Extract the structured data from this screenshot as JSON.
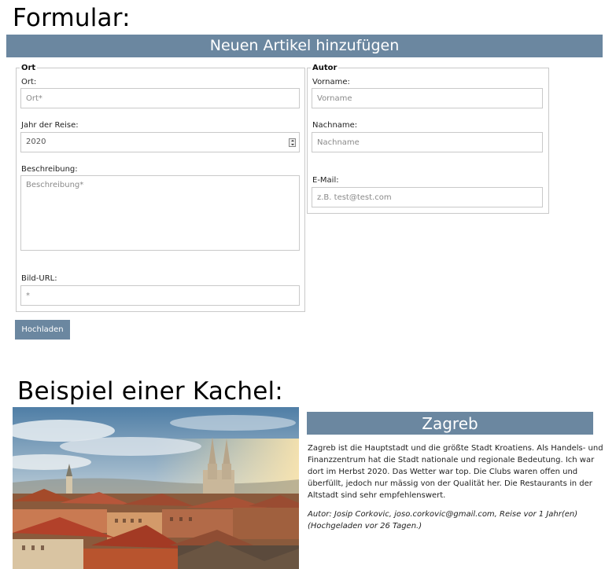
{
  "headings": {
    "form": "Formular:",
    "tile": "Beispiel einer Kachel:"
  },
  "form": {
    "title": "Neuen Artikel hinzufügen",
    "ort_group": {
      "legend": "Ort",
      "ort_label": "Ort:",
      "ort_placeholder": "Ort*",
      "year_label": "Jahr der Reise:",
      "year_value": "2020",
      "desc_label": "Beschreibung:",
      "desc_placeholder": "Beschreibung*",
      "url_label": "Bild-URL:",
      "url_placeholder": "*"
    },
    "author_group": {
      "legend": "Autor",
      "firstname_label": "Vorname:",
      "firstname_placeholder": "Vorname",
      "lastname_label": "Nachname:",
      "lastname_placeholder": "Nachname",
      "email_label": "E-Mail:",
      "email_placeholder": "z.B. test@test.com"
    },
    "upload_button": "Hochladen"
  },
  "tile": {
    "title": "Zagreb",
    "description_lines": [
      "Zagreb ist die Hauptstadt und die größte Stadt Kroatiens. Als Handels- und",
      "Finanzzentrum hat die Stadt nationale und regionale Bedeutung. Ich war",
      "dort im Herbst 2020. Das Wetter war top. Die Clubs waren offen und",
      "überfüllt, jedoch nur mässig von der Qualität her. Die Restaurants in der",
      "Altstadt sind sehr empfehlenswert."
    ],
    "meta_lines": [
      "Autor: Josip Corkovic, joso.corkovic@gmail.com, Reise vor 1 Jahr(en)",
      "(Hochgeladen vor 26 Tagen.)"
    ]
  },
  "colors": {
    "accent": "#6b87a0",
    "border": "#c9c9c9"
  }
}
